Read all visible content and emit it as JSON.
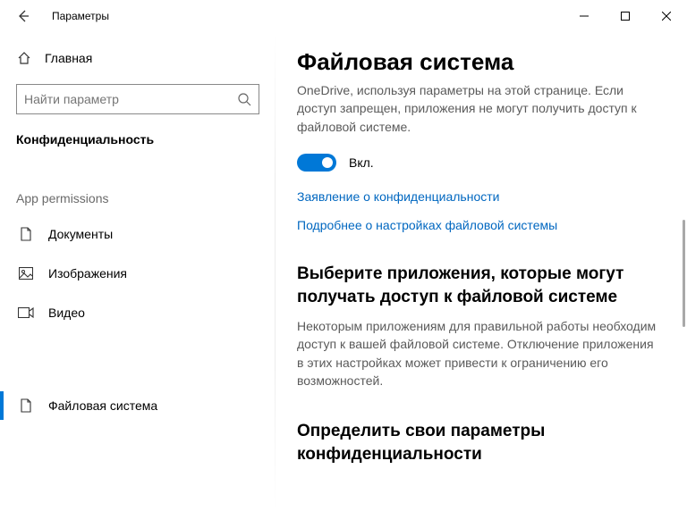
{
  "titlebar": {
    "title": "Параметры"
  },
  "sidebar": {
    "home": "Главная",
    "search_placeholder": "Найти параметр",
    "category": "Конфиденциальность",
    "group": "App permissions",
    "items": [
      {
        "label": "Документы"
      },
      {
        "label": "Изображения"
      },
      {
        "label": "Видео"
      },
      {
        "label": "Файловая система"
      }
    ]
  },
  "main": {
    "heading": "Файловая система",
    "intro": "OneDrive, используя параметры на этой странице. Если доступ запрещен, приложения не могут получить доступ к файловой системе.",
    "toggle_label": "Вкл.",
    "link1": "Заявление о конфиденциальности",
    "link2": "Подробнее о настройках файловой системы",
    "section2_h": "Выберите приложения, которые могут получать доступ к файловой системе",
    "section2_b": "Некоторым приложениям для правильной работы необходим доступ к вашей файловой системе. Отключение приложения в этих настройках может привести к ограничению его возможностей.",
    "section3_h": "Определить свои параметры конфиденциальности"
  }
}
